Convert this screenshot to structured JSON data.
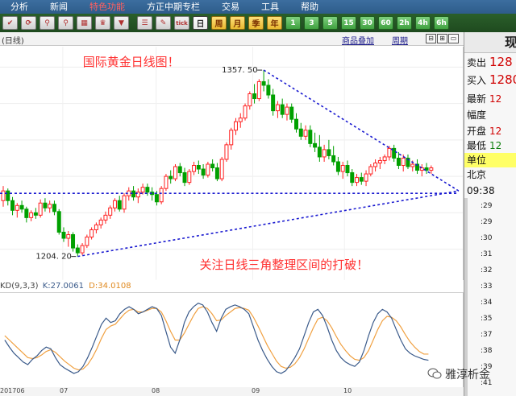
{
  "menu": {
    "items": [
      {
        "label": "分析",
        "active": false
      },
      {
        "label": "新闻",
        "active": false
      },
      {
        "label": "特色功能",
        "active": true
      },
      {
        "label": "方正中期专栏",
        "active": false
      },
      {
        "label": "交易",
        "active": false
      },
      {
        "label": "工具",
        "active": false
      },
      {
        "label": "帮助",
        "active": false
      }
    ]
  },
  "toolbar": {
    "icons": [
      "toolbar-icon-1",
      "refresh-icon",
      "search-icon",
      "zoom-icon",
      "chart-icon",
      "gold-icon",
      "funnel-icon"
    ],
    "list_icon": "list-icon",
    "draw_icon": "draw-icon",
    "tick_label": "tick",
    "periods": [
      {
        "label": "日",
        "selected": true
      },
      {
        "label": "周",
        "selected": false
      },
      {
        "label": "月",
        "selected": false
      },
      {
        "label": "季",
        "selected": false
      },
      {
        "label": "年",
        "selected": false
      }
    ],
    "minutes": [
      "1",
      "3",
      "5",
      "15",
      "30",
      "60",
      "2h",
      "4h",
      "6h"
    ]
  },
  "chart_header": {
    "period_label": "(日线)",
    "overlay_link": "商品叠加",
    "cycle_link": "周期"
  },
  "chart": {
    "annotation_title": "国际黄金日线图！",
    "annotation_note": "关注日线三角整理区间的打破！",
    "high_label": "1357. 50",
    "low_label": "1204. 20",
    "kdj_label": "KD(9,3,3)",
    "k_label": "K:27.0061",
    "d_label": "D:34.0108",
    "date_labels": [
      "201706",
      "07",
      "08",
      "09",
      "10"
    ],
    "colors": {
      "up": "#ff2020",
      "down": "#00a000",
      "trend": "#1a1ad0",
      "k_line": "#3a5a8a",
      "d_line": "#f0a040",
      "annotation": "#ff3030"
    }
  },
  "chart_data": {
    "type": "candlestick",
    "title": "",
    "price_high": 1357.5,
    "price_low": 1204.2,
    "candles": [
      {
        "o": 1250,
        "h": 1262,
        "l": 1245,
        "c": 1258
      },
      {
        "o": 1258,
        "h": 1260,
        "l": 1246,
        "c": 1250
      },
      {
        "o": 1250,
        "h": 1253,
        "l": 1238,
        "c": 1242
      },
      {
        "o": 1242,
        "h": 1248,
        "l": 1236,
        "c": 1246
      },
      {
        "o": 1246,
        "h": 1250,
        "l": 1240,
        "c": 1243
      },
      {
        "o": 1243,
        "h": 1245,
        "l": 1232,
        "c": 1236
      },
      {
        "o": 1236,
        "h": 1242,
        "l": 1233,
        "c": 1240
      },
      {
        "o": 1240,
        "h": 1244,
        "l": 1235,
        "c": 1238
      },
      {
        "o": 1238,
        "h": 1251,
        "l": 1236,
        "c": 1248
      },
      {
        "o": 1248,
        "h": 1252,
        "l": 1241,
        "c": 1244
      },
      {
        "o": 1244,
        "h": 1250,
        "l": 1240,
        "c": 1247
      },
      {
        "o": 1247,
        "h": 1250,
        "l": 1238,
        "c": 1241
      },
      {
        "o": 1241,
        "h": 1243,
        "l": 1222,
        "c": 1224
      },
      {
        "o": 1224,
        "h": 1228,
        "l": 1216,
        "c": 1219
      },
      {
        "o": 1219,
        "h": 1225,
        "l": 1212,
        "c": 1222
      },
      {
        "o": 1222,
        "h": 1224,
        "l": 1208,
        "c": 1211
      },
      {
        "o": 1211,
        "h": 1214,
        "l": 1204,
        "c": 1207
      },
      {
        "o": 1207,
        "h": 1215,
        "l": 1205,
        "c": 1213
      },
      {
        "o": 1213,
        "h": 1222,
        "l": 1211,
        "c": 1220
      },
      {
        "o": 1220,
        "h": 1228,
        "l": 1218,
        "c": 1226
      },
      {
        "o": 1226,
        "h": 1232,
        "l": 1223,
        "c": 1230
      },
      {
        "o": 1230,
        "h": 1236,
        "l": 1227,
        "c": 1234
      },
      {
        "o": 1234,
        "h": 1241,
        "l": 1231,
        "c": 1238
      },
      {
        "o": 1238,
        "h": 1246,
        "l": 1235,
        "c": 1244
      },
      {
        "o": 1244,
        "h": 1252,
        "l": 1241,
        "c": 1250
      },
      {
        "o": 1250,
        "h": 1254,
        "l": 1241,
        "c": 1243
      },
      {
        "o": 1243,
        "h": 1256,
        "l": 1240,
        "c": 1254
      },
      {
        "o": 1254,
        "h": 1261,
        "l": 1250,
        "c": 1258
      },
      {
        "o": 1258,
        "h": 1262,
        "l": 1250,
        "c": 1253
      },
      {
        "o": 1253,
        "h": 1260,
        "l": 1248,
        "c": 1257
      },
      {
        "o": 1257,
        "h": 1264,
        "l": 1255,
        "c": 1261
      },
      {
        "o": 1261,
        "h": 1264,
        "l": 1254,
        "c": 1257
      },
      {
        "o": 1257,
        "h": 1261,
        "l": 1250,
        "c": 1255
      },
      {
        "o": 1255,
        "h": 1258,
        "l": 1246,
        "c": 1249
      },
      {
        "o": 1249,
        "h": 1262,
        "l": 1247,
        "c": 1260
      },
      {
        "o": 1260,
        "h": 1272,
        "l": 1258,
        "c": 1270
      },
      {
        "o": 1270,
        "h": 1275,
        "l": 1264,
        "c": 1268
      },
      {
        "o": 1268,
        "h": 1280,
        "l": 1266,
        "c": 1278
      },
      {
        "o": 1278,
        "h": 1281,
        "l": 1270,
        "c": 1273
      },
      {
        "o": 1273,
        "h": 1277,
        "l": 1262,
        "c": 1265
      },
      {
        "o": 1265,
        "h": 1276,
        "l": 1263,
        "c": 1274
      },
      {
        "o": 1274,
        "h": 1282,
        "l": 1271,
        "c": 1279
      },
      {
        "o": 1279,
        "h": 1283,
        "l": 1272,
        "c": 1276
      },
      {
        "o": 1276,
        "h": 1280,
        "l": 1268,
        "c": 1271
      },
      {
        "o": 1271,
        "h": 1282,
        "l": 1269,
        "c": 1280
      },
      {
        "o": 1280,
        "h": 1284,
        "l": 1274,
        "c": 1277
      },
      {
        "o": 1277,
        "h": 1281,
        "l": 1266,
        "c": 1268
      },
      {
        "o": 1268,
        "h": 1286,
        "l": 1266,
        "c": 1284
      },
      {
        "o": 1284,
        "h": 1298,
        "l": 1282,
        "c": 1296
      },
      {
        "o": 1296,
        "h": 1310,
        "l": 1292,
        "c": 1308
      },
      {
        "o": 1308,
        "h": 1318,
        "l": 1304,
        "c": 1315
      },
      {
        "o": 1315,
        "h": 1322,
        "l": 1310,
        "c": 1318
      },
      {
        "o": 1318,
        "h": 1330,
        "l": 1316,
        "c": 1328
      },
      {
        "o": 1328,
        "h": 1340,
        "l": 1325,
        "c": 1338
      },
      {
        "o": 1338,
        "h": 1346,
        "l": 1330,
        "c": 1334
      },
      {
        "o": 1334,
        "h": 1350,
        "l": 1332,
        "c": 1348
      },
      {
        "o": 1348,
        "h": 1357.5,
        "l": 1340,
        "c": 1345
      },
      {
        "o": 1345,
        "h": 1350,
        "l": 1334,
        "c": 1337
      },
      {
        "o": 1337,
        "h": 1342,
        "l": 1320,
        "c": 1324
      },
      {
        "o": 1324,
        "h": 1332,
        "l": 1318,
        "c": 1329
      },
      {
        "o": 1329,
        "h": 1334,
        "l": 1318,
        "c": 1321
      },
      {
        "o": 1321,
        "h": 1330,
        "l": 1316,
        "c": 1327
      },
      {
        "o": 1327,
        "h": 1330,
        "l": 1314,
        "c": 1317
      },
      {
        "o": 1317,
        "h": 1322,
        "l": 1306,
        "c": 1309
      },
      {
        "o": 1309,
        "h": 1314,
        "l": 1300,
        "c": 1303
      },
      {
        "o": 1303,
        "h": 1312,
        "l": 1300,
        "c": 1308
      },
      {
        "o": 1308,
        "h": 1312,
        "l": 1294,
        "c": 1297
      },
      {
        "o": 1297,
        "h": 1306,
        "l": 1290,
        "c": 1294
      },
      {
        "o": 1294,
        "h": 1304,
        "l": 1282,
        "c": 1286
      },
      {
        "o": 1286,
        "h": 1296,
        "l": 1282,
        "c": 1292
      },
      {
        "o": 1292,
        "h": 1300,
        "l": 1284,
        "c": 1287
      },
      {
        "o": 1287,
        "h": 1295,
        "l": 1279,
        "c": 1282
      },
      {
        "o": 1282,
        "h": 1286,
        "l": 1271,
        "c": 1274
      },
      {
        "o": 1274,
        "h": 1282,
        "l": 1268,
        "c": 1279
      },
      {
        "o": 1279,
        "h": 1283,
        "l": 1270,
        "c": 1273
      },
      {
        "o": 1273,
        "h": 1276,
        "l": 1262,
        "c": 1265
      },
      {
        "o": 1265,
        "h": 1272,
        "l": 1262,
        "c": 1269
      },
      {
        "o": 1269,
        "h": 1273,
        "l": 1263,
        "c": 1266
      },
      {
        "o": 1266,
        "h": 1275,
        "l": 1262,
        "c": 1272
      },
      {
        "o": 1272,
        "h": 1280,
        "l": 1270,
        "c": 1278
      },
      {
        "o": 1278,
        "h": 1284,
        "l": 1274,
        "c": 1281
      },
      {
        "o": 1281,
        "h": 1286,
        "l": 1276,
        "c": 1283
      },
      {
        "o": 1283,
        "h": 1288,
        "l": 1280,
        "c": 1286
      },
      {
        "o": 1286,
        "h": 1295,
        "l": 1283,
        "c": 1293
      },
      {
        "o": 1293,
        "h": 1296,
        "l": 1282,
        "c": 1285
      },
      {
        "o": 1285,
        "h": 1290,
        "l": 1276,
        "c": 1279
      },
      {
        "o": 1279,
        "h": 1288,
        "l": 1274,
        "c": 1285
      },
      {
        "o": 1285,
        "h": 1288,
        "l": 1276,
        "c": 1278
      },
      {
        "o": 1278,
        "h": 1283,
        "l": 1274,
        "c": 1280
      },
      {
        "o": 1280,
        "h": 1284,
        "l": 1272,
        "c": 1275
      },
      {
        "o": 1275,
        "h": 1280,
        "l": 1270,
        "c": 1277
      },
      {
        "o": 1277,
        "h": 1281,
        "l": 1272,
        "c": 1275
      },
      {
        "o": 1275,
        "h": 1279,
        "l": 1272,
        "c": 1277
      }
    ],
    "kdj": {
      "k": [
        50,
        42,
        35,
        30,
        25,
        22,
        28,
        32,
        38,
        42,
        40,
        30,
        22,
        18,
        15,
        12,
        14,
        20,
        30,
        42,
        55,
        68,
        75,
        70,
        72,
        80,
        85,
        88,
        85,
        80,
        82,
        85,
        88,
        86,
        78,
        60,
        42,
        35,
        50,
        70,
        82,
        88,
        92,
        90,
        82,
        70,
        60,
        75,
        85,
        88,
        90,
        88,
        85,
        80,
        65,
        50,
        38,
        28,
        20,
        14,
        12,
        15,
        22,
        30,
        40,
        55,
        70,
        82,
        85,
        78,
        65,
        50,
        38,
        30,
        25,
        22,
        20,
        25,
        38,
        55,
        70,
        80,
        85,
        82,
        75,
        62,
        50,
        40,
        35,
        32,
        30,
        28,
        27
      ],
      "d": [
        55,
        50,
        45,
        40,
        35,
        30,
        29,
        30,
        33,
        37,
        39,
        36,
        31,
        26,
        22,
        18,
        16,
        17,
        22,
        30,
        40,
        52,
        62,
        66,
        68,
        74,
        80,
        84,
        85,
        82,
        82,
        84,
        86,
        86,
        82,
        72,
        60,
        50,
        50,
        58,
        68,
        78,
        86,
        88,
        86,
        80,
        72,
        73,
        78,
        82,
        86,
        87,
        86,
        84,
        76,
        66,
        55,
        44,
        35,
        26,
        20,
        18,
        19,
        23,
        30,
        40,
        52,
        64,
        74,
        76,
        72,
        64,
        54,
        45,
        38,
        32,
        28,
        27,
        30,
        38,
        50,
        62,
        72,
        77,
        76,
        72,
        65,
        56,
        48,
        42,
        37,
        34,
        34
      ]
    },
    "k_value": 27.0061,
    "d_value": 34.0108
  },
  "right_panel": {
    "title": "现",
    "rows": [
      {
        "label": "卖出",
        "value": "128",
        "color": "red"
      },
      {
        "label": "买入",
        "value": "1280",
        "color": "red"
      },
      {
        "label": "最新",
        "value": "12",
        "color": "red"
      },
      {
        "label": "幅度",
        "value": "",
        "color": "red"
      },
      {
        "label": "开盘",
        "value": "12",
        "color": "red"
      },
      {
        "label": "最低",
        "value": "12",
        "color": "green"
      }
    ],
    "unit_label": "单位",
    "city": "北京",
    "time": "09:38",
    "ticks": [
      ":29",
      ":29",
      ":30",
      ":31",
      ":32",
      ":33",
      ":34",
      ":35",
      ":37",
      ":38",
      ":39",
      ":41"
    ]
  },
  "watermark": "雅淳析金"
}
